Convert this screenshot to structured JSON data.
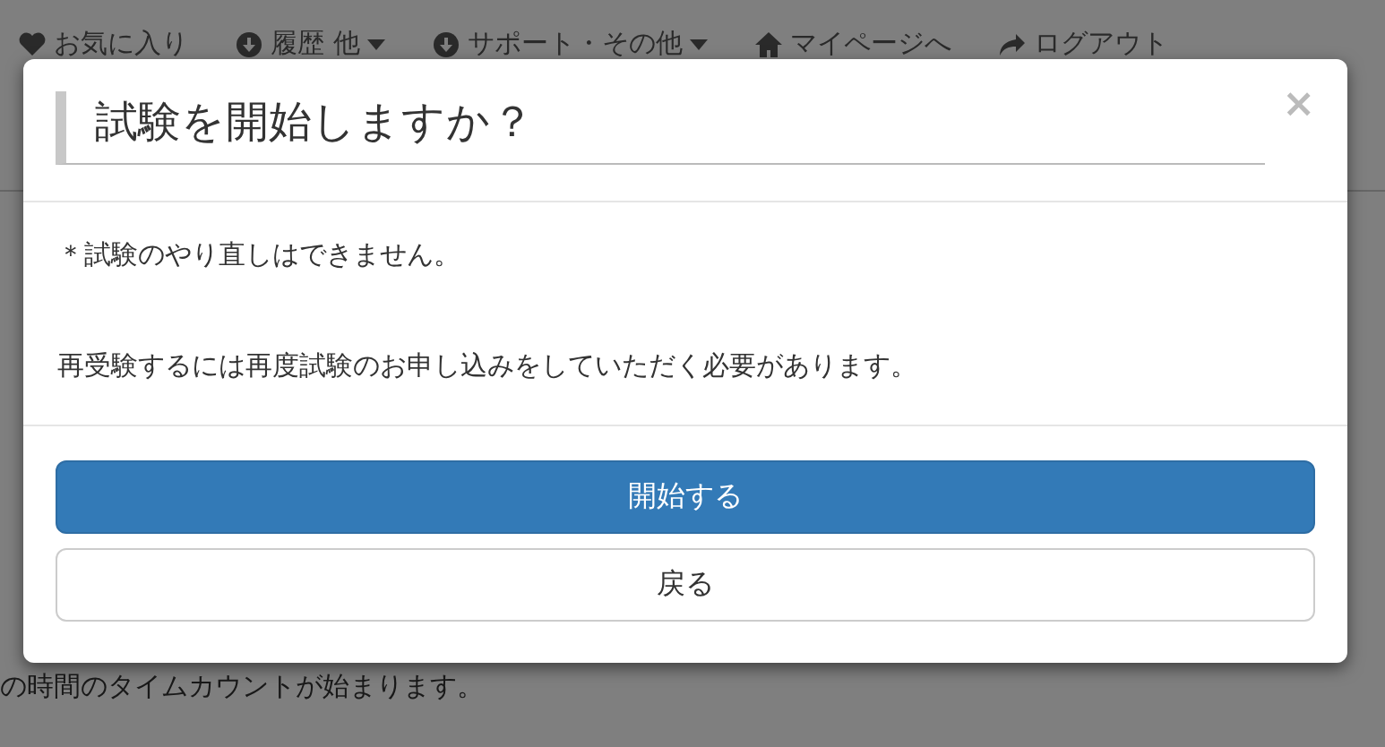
{
  "background_page": {
    "nav_items": [
      {
        "label": "お気に入り",
        "kind": "heart",
        "dropdown": false
      },
      {
        "label": "履歴 他",
        "kind": "download",
        "dropdown": true
      },
      {
        "label": "サポート・その他",
        "kind": "download",
        "dropdown": true
      },
      {
        "label": "マイページへ",
        "kind": "home",
        "dropdown": false
      },
      {
        "label": "ログアウト",
        "kind": "share",
        "dropdown": false
      }
    ],
    "text": "の時間のタイムカウントが始まります。"
  },
  "modal": {
    "title": "試験を開始しますか？",
    "close": "×",
    "body": [
      "＊試験のやり直しはできません。",
      "再受験するには再度試験のお申し込みをしていただく必要があります。"
    ],
    "buttons": [
      {
        "label": "開始する",
        "kind": "primary"
      },
      {
        "label": "戻る",
        "kind": "secondary"
      }
    ]
  }
}
